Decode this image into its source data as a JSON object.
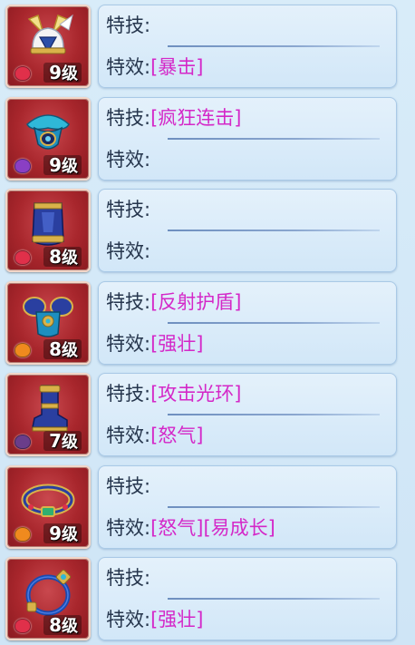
{
  "rows": [
    {
      "slot": "helmet",
      "level_num": "9",
      "level_unit": "级",
      "skill_label": "特技:",
      "skill_value": "",
      "effect_label": "特效:",
      "effect_value": "[暴击]",
      "gem_color": "#e0304a"
    },
    {
      "slot": "necklace",
      "level_num": "9",
      "level_unit": "级",
      "skill_label": "特技:",
      "skill_value": "[疯狂连击]",
      "effect_label": "特效:",
      "effect_value": "",
      "gem_color": "#8a3fc4"
    },
    {
      "slot": "armor",
      "level_num": "8",
      "level_unit": "级",
      "skill_label": "特技:",
      "skill_value": "",
      "effect_label": "特效:",
      "effect_value": "",
      "gem_color": "#e0304a"
    },
    {
      "slot": "shoulder-armor",
      "level_num": "8",
      "level_unit": "级",
      "skill_label": "特技:",
      "skill_value": "[反射护盾]",
      "effect_label": "特效:",
      "effect_value": "[强壮]",
      "gem_color": "#f08a1e"
    },
    {
      "slot": "boots",
      "level_num": "7",
      "level_unit": "级",
      "skill_label": "特技:",
      "skill_value": "[攻击光环]",
      "effect_label": "特效:",
      "effect_value": "[怒气]",
      "gem_color": "#6a3d8a"
    },
    {
      "slot": "belt",
      "level_num": "9",
      "level_unit": "级",
      "skill_label": "特技:",
      "skill_value": "",
      "effect_label": "特效:",
      "effect_value": "[怒气][易成长]",
      "gem_color": "#f08a1e"
    },
    {
      "slot": "bracelet",
      "level_num": "8",
      "level_unit": "级",
      "skill_label": "特技:",
      "skill_value": "",
      "effect_label": "特效:",
      "effect_value": "[强壮]",
      "gem_color": "#e0304a"
    }
  ],
  "colors": {
    "label": "#26364d",
    "value": "#d428c8",
    "icon_bg": "#a8262c",
    "panel_bg": "#dcecf9"
  }
}
